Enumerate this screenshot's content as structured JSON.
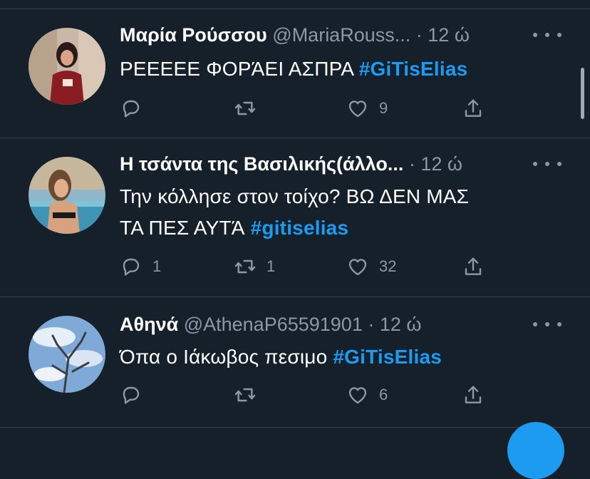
{
  "colors": {
    "background": "#15202b",
    "text": "#ffffff",
    "muted": "#8b98a5",
    "hashtag": "#1d9bf0",
    "divider": "#38444d"
  },
  "tweets": [
    {
      "name": "Μαρία Ρούσσου",
      "handle": "@MariaRouss...",
      "dot": "·",
      "time": "12 ώ",
      "text_lines": [
        {
          "text": "ΡΕΕΕΕΕ ΦΟΡΆΕΙ ΑΣΠΡΑ ",
          "hashtag": "#GiTisElias"
        }
      ],
      "replies": "",
      "retweets": "",
      "likes": "9",
      "icons": [
        "reply-icon",
        "retweet-icon",
        "like-icon",
        "share-icon",
        "more-icon"
      ]
    },
    {
      "name": "Η τσάντα της Βασιλικής(άλλο...",
      "handle": "",
      "dot": "·",
      "time": "12 ώ",
      "text_lines": [
        {
          "text": "Την κόλλησε στον τοίχο? ΒΩ ΔΕΝ ΜΑΣ",
          "hashtag": ""
        },
        {
          "text": "ΤΑ ΠΕΣ ΑΥΤΆ ",
          "hashtag": "#gitiselias"
        }
      ],
      "replies": "1",
      "retweets": "1",
      "likes": "32",
      "icons": [
        "reply-icon",
        "retweet-icon",
        "like-icon",
        "share-icon",
        "more-icon"
      ]
    },
    {
      "name": "Αθηνά",
      "handle": "@AthenaP65591901",
      "dot": "·",
      "time": "12 ώ",
      "text_lines": [
        {
          "text": "Όπα ο Ιάκωβος πεσιμο ",
          "hashtag": "#GiTisElias"
        }
      ],
      "replies": "",
      "retweets": "",
      "likes": "6",
      "icons": [
        "reply-icon",
        "retweet-icon",
        "like-icon",
        "share-icon",
        "more-icon"
      ]
    }
  ]
}
